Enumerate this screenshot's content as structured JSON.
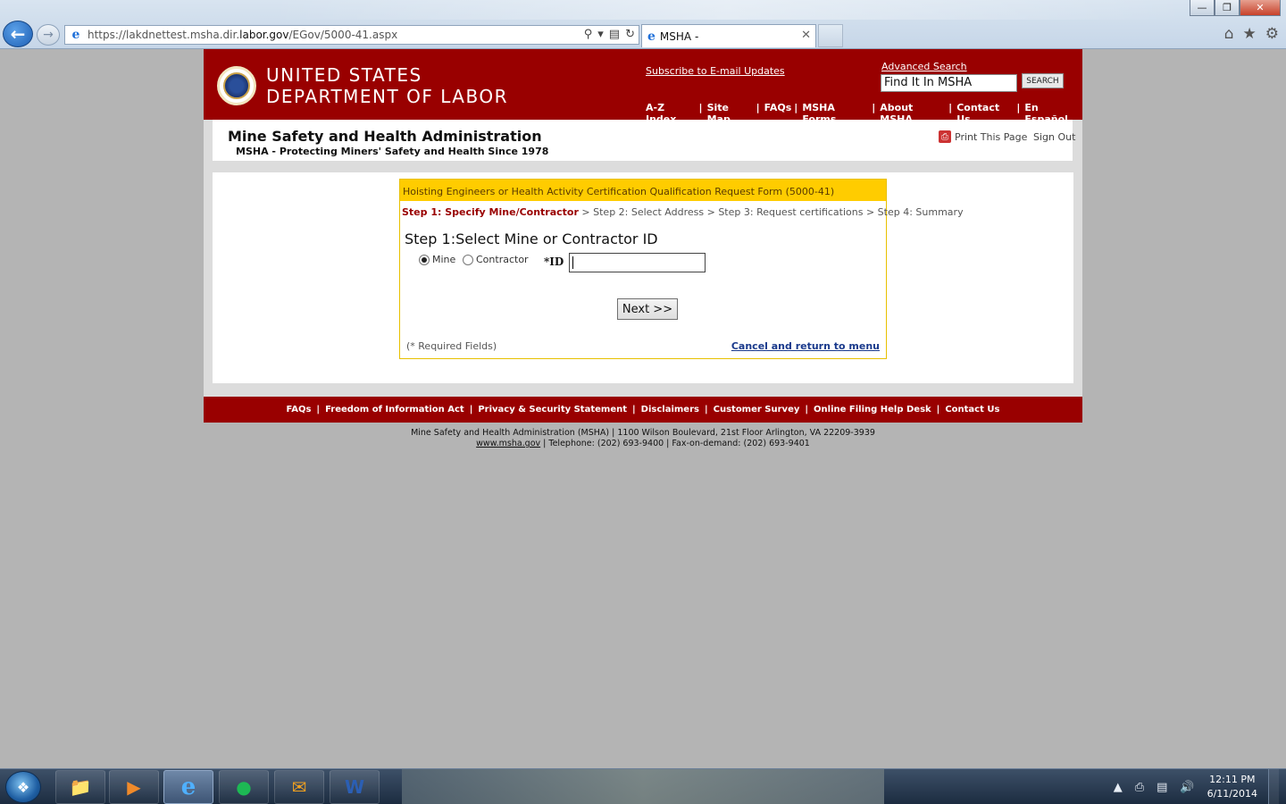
{
  "browser": {
    "address_url_prefix": "https://lakdnettest.msha.dir.",
    "address_url_domain": "labor.gov",
    "address_url_path": "/EGov/5000-41.aspx",
    "tab_title": "MSHA -",
    "window_controls": [
      "minimize-icon",
      "restore-icon",
      "close-icon"
    ],
    "right_icons": [
      "home-icon",
      "favorites-star-icon",
      "settings-gear-icon"
    ]
  },
  "header": {
    "dol_line1": "UNITED STATES",
    "dol_line2": "DEPARTMENT OF LABOR",
    "subscribe_link": "Subscribe to E-mail Updates",
    "advanced_search_link": "Advanced Search",
    "search_value": "Find It In MSHA",
    "search_button": "SEARCH",
    "nav": [
      "A-Z Index",
      "Site Map",
      "FAQs",
      "MSHA Forms",
      "About MSHA",
      "Contact Us",
      "En Español"
    ]
  },
  "titlebar": {
    "agency": "Mine Safety and Health Administration",
    "tagline": "MSHA - Protecting Miners' Safety and Health Since 1978",
    "print_link": "Print This Page",
    "signout_link": "Sign Out"
  },
  "form": {
    "heading": "Hoisting Engineers or Health Activity Certification Qualification Request Form (5000-41)",
    "step_current": "Step 1: Specify Mine/Contractor",
    "steps_rest": " > Step 2: Select Address > Step 3: Request certifications > Step 4: Summary",
    "step_title": "Step 1:Select Mine or Contractor ID",
    "radio_mine": "Mine",
    "radio_contractor": "Contractor",
    "selected_type": "Mine",
    "id_label": "*ID",
    "id_value": "",
    "next_button": "Next >>",
    "required_note": "(* Required Fields)",
    "cancel_link": "Cancel and return to menu"
  },
  "footer": {
    "links": [
      "FAQs",
      "Freedom of Information Act",
      "Privacy & Security Statement",
      "Disclaimers",
      "Customer Survey",
      "Online Filing Help Desk",
      "Contact Us"
    ],
    "address_line": "Mine Safety and Health Administration (MSHA) | 1100 Wilson Boulevard, 21st Floor Arlington, VA 22209-3939",
    "site_link": "www.msha.gov",
    "phone_line": " | Telephone: (202) 693-9400 | Fax-on-demand: (202) 693-9401"
  },
  "taskbar": {
    "apps": [
      "file-explorer-icon",
      "media-player-icon",
      "internet-explorer-icon",
      "spotify-icon",
      "outlook-icon",
      "word-icon"
    ],
    "active_app": "internet-explorer-icon",
    "time": "12:11 PM",
    "date": "6/11/2014"
  },
  "colors": {
    "brand_red": "#990000",
    "form_header_yellow": "#ffcc00",
    "link_blue": "#1a3a8c"
  }
}
